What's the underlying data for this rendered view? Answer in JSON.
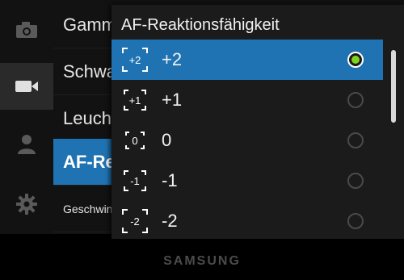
{
  "background_menu": {
    "items": [
      {
        "label": "Gamma"
      },
      {
        "label": "Schwarz"
      },
      {
        "label": "Leuchte"
      },
      {
        "label": "AF-Reaktionsfähigkeit"
      },
      {
        "label": "Geschwindigkeit"
      }
    ]
  },
  "sidebar_icons": [
    "camera-icon",
    "video-camera-icon",
    "person-icon",
    "gear-icon"
  ],
  "popup": {
    "title": "AF-Reaktionsfähigkeit",
    "options": [
      {
        "icon_text": "+2",
        "label": "+2",
        "selected": true
      },
      {
        "icon_text": "+1",
        "label": "+1",
        "selected": false
      },
      {
        "icon_text": "0",
        "label": "0",
        "selected": false
      },
      {
        "icon_text": "-1",
        "label": "-1",
        "selected": false
      },
      {
        "icon_text": "-2",
        "label": "-2",
        "selected": false
      }
    ]
  },
  "brand": "SAMSUNG",
  "colors": {
    "accent": "#1f73b3",
    "radio_on": "#7ed321"
  }
}
